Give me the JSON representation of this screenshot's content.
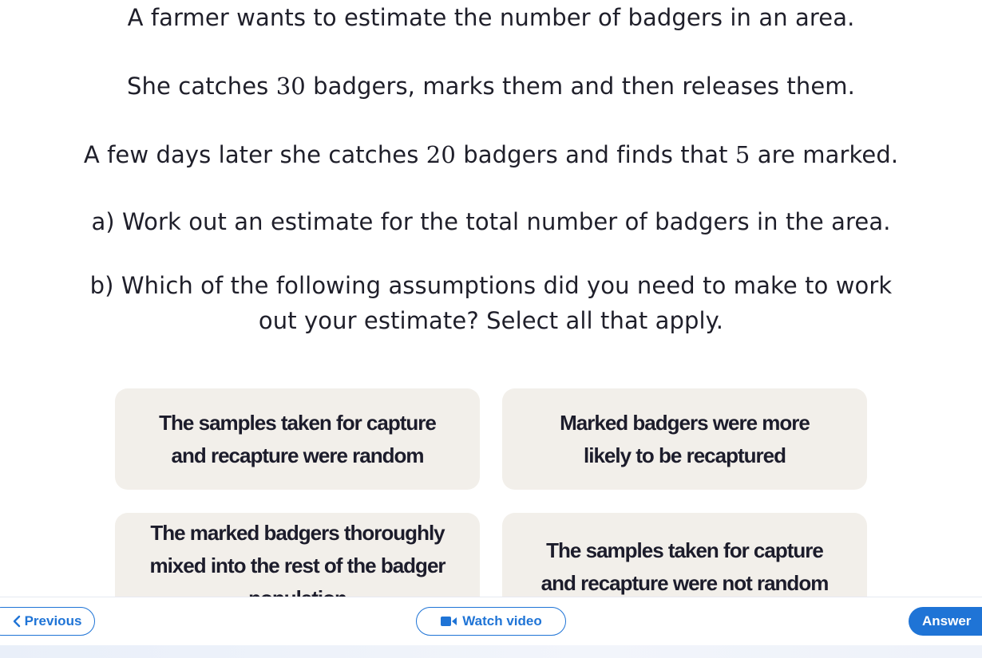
{
  "question": {
    "line1": "A farmer wants to estimate the number of badgers in an area.",
    "line2": {
      "before": "She catches ",
      "n1": "30",
      "after": " badgers, marks them and then releases them."
    },
    "line3": {
      "before": "A few days later she catches ",
      "n1": "20",
      "middle": " badgers and finds that ",
      "n2": "5",
      "after": " are marked."
    },
    "part_a": "a) Work out an estimate for the total number of badgers in the area.",
    "part_b_line1": "b) Which of the following assumptions did you need to make to work",
    "part_b_line2": "out your estimate? Select all that apply."
  },
  "options": [
    {
      "line1": "The samples taken for capture",
      "line2": "and recapture were random"
    },
    {
      "line1": "Marked badgers were more",
      "line2": "likely to be recaptured"
    },
    {
      "line1": "The marked badgers thoroughly",
      "line2": "mixed into the rest of the badger",
      "line3": "population"
    },
    {
      "line1": "The samples taken for capture",
      "line2": "and recapture were not random"
    }
  ],
  "nav": {
    "previous_label": "Previous",
    "watch_video_label": "Watch video",
    "answer_label": "Answer"
  },
  "colors": {
    "accent": "#1f74d6",
    "option_bg": "#f2efea",
    "text": "#1f1f2a"
  },
  "icons": {
    "previous": "chevron-left-icon",
    "watch": "video-camera-icon"
  }
}
